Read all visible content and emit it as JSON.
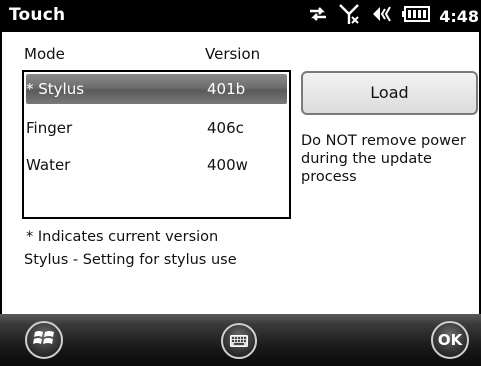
{
  "titlebar": {
    "title": "Touch",
    "clock": "4:48",
    "icons": [
      "data-sync-icon",
      "no-signal-icon",
      "speaker-icon",
      "battery-icon"
    ]
  },
  "columns": {
    "mode": "Mode",
    "version": "Version"
  },
  "list": {
    "items": [
      {
        "mode": "* Stylus",
        "version": "401b",
        "selected": true
      },
      {
        "mode": "Finger",
        "version": "406c",
        "selected": false
      },
      {
        "mode": "Water",
        "version": "400w",
        "selected": false
      }
    ]
  },
  "load_button": "Load",
  "warning_text": "Do NOT remove power during the update process",
  "note_current": "* Indicates current version",
  "note_selected": "Stylus - Setting for stylus use",
  "bottombar": {
    "ok_label": "OK",
    "icons": [
      "windows-start-icon",
      "keyboard-icon"
    ]
  },
  "colors": {
    "selection": "#6d6d6d",
    "titlebar": "#000000"
  }
}
